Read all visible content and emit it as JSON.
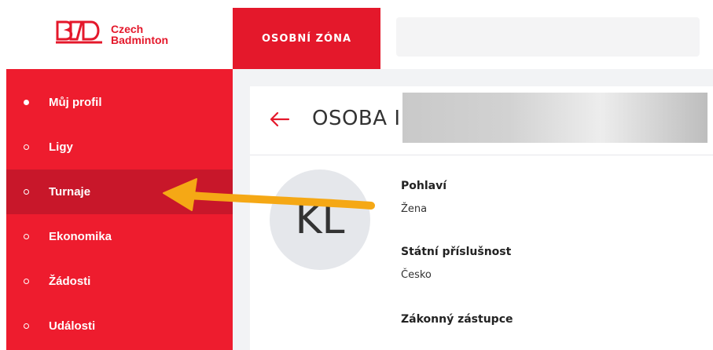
{
  "brand": {
    "line1": "Czech",
    "line2": "Badminton",
    "color": "#e4182b"
  },
  "header": {
    "zone_tab": "OSOBNÍ ZÓNA"
  },
  "sidebar": {
    "items": [
      {
        "label": "Můj profil",
        "active": false,
        "bullet": "filled"
      },
      {
        "label": "Ligy",
        "active": false,
        "bullet": "outline"
      },
      {
        "label": "Turnaje",
        "active": true,
        "bullet": "outline"
      },
      {
        "label": "Ekonomika",
        "active": false,
        "bullet": "outline"
      },
      {
        "label": "Žádosti",
        "active": false,
        "bullet": "outline"
      },
      {
        "label": "Události",
        "active": false,
        "bullet": "outline"
      }
    ]
  },
  "main": {
    "title": "OSOBA I",
    "avatar_initials": "KL",
    "fields": [
      {
        "label": "Pohlaví",
        "value": "Žena"
      },
      {
        "label": "Státní příslušnost",
        "value": "Česko"
      },
      {
        "label": "Zákonný zástupce",
        "value": ""
      }
    ]
  },
  "colors": {
    "sidebar": "#ee1c2e",
    "active_item": "#c8172a",
    "annotation_arrow": "#f5a815"
  },
  "icons": {
    "back": "arrow-left-icon",
    "annotation": "arrow-annotation"
  }
}
